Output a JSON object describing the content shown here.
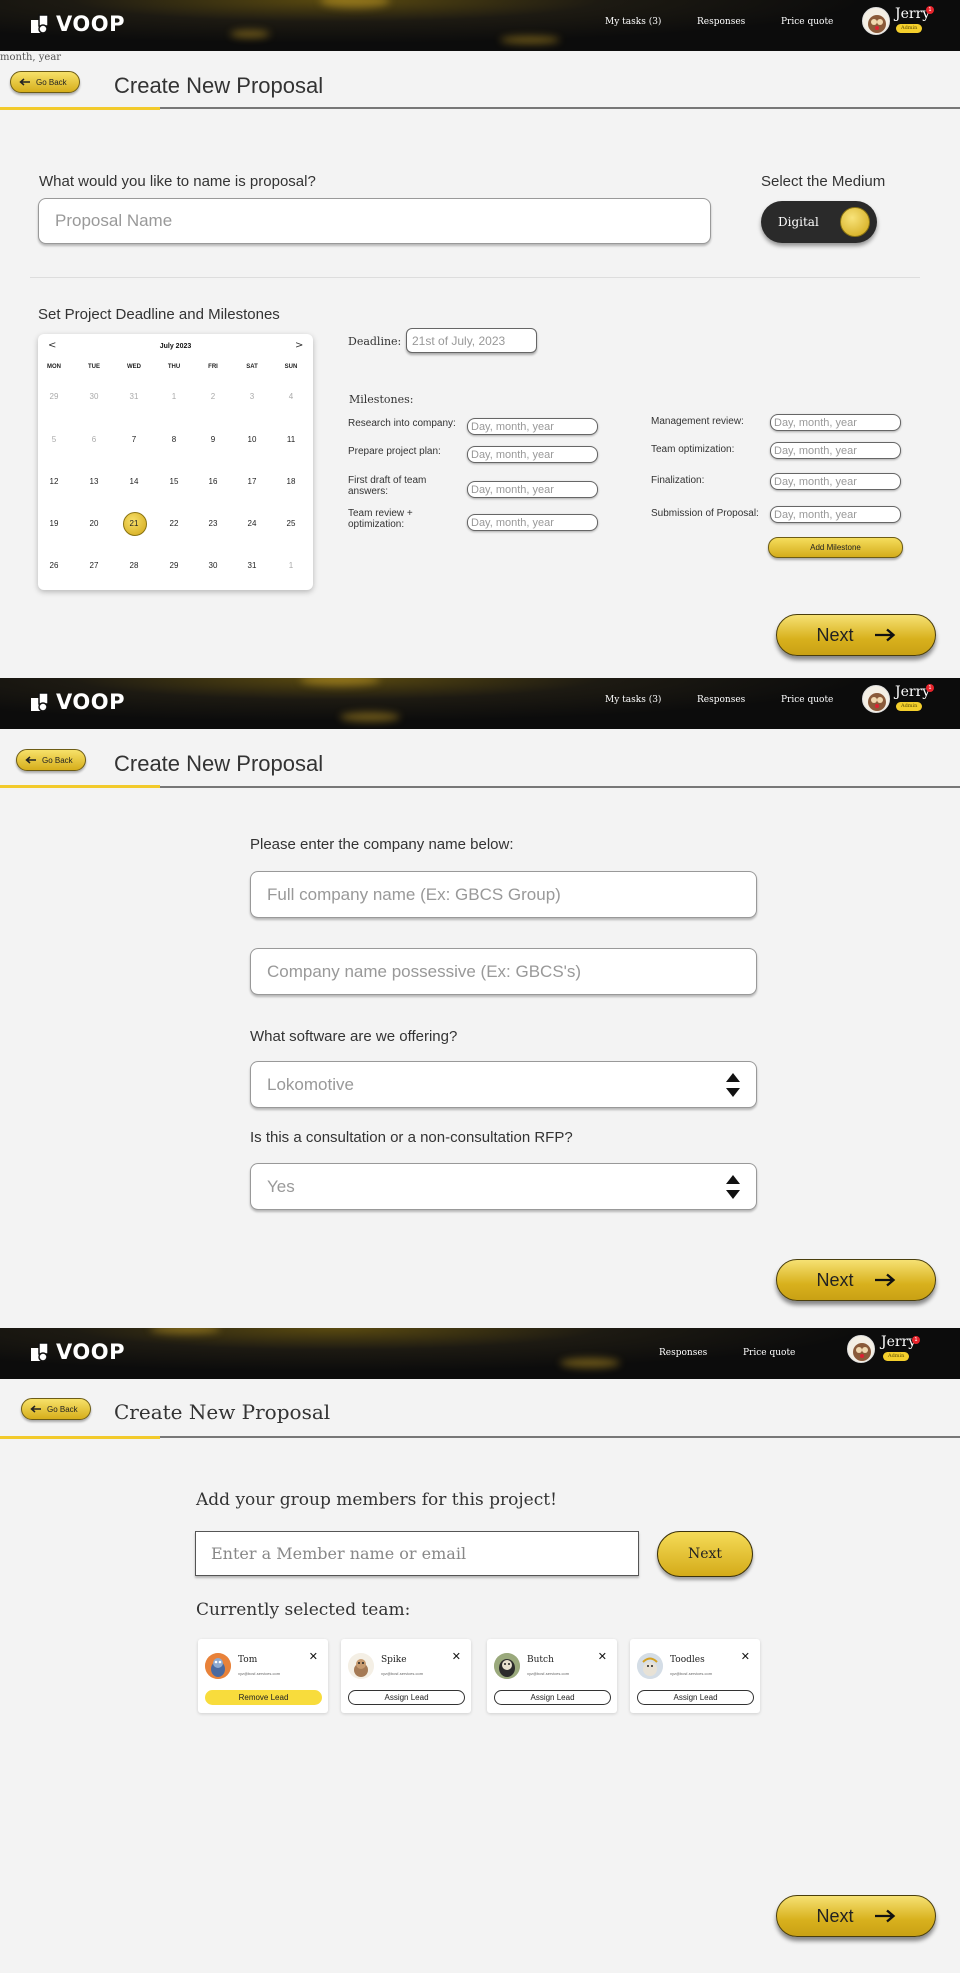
{
  "app": {
    "brand": "VOOP",
    "user": {
      "name": "Jerry",
      "role": "Admin",
      "notifications": "1"
    }
  },
  "screen1": {
    "nav": [
      "My tasks (3)",
      "Responses",
      "Price quote"
    ],
    "stray_text": "month, year",
    "go_back": "Go Back",
    "title": "Create New Proposal",
    "proposal_question": "What would you like to name is proposal?",
    "proposal_placeholder": "Proposal Name",
    "medium_label": "Select the Medium",
    "medium_value": "Digital",
    "deadline_section_title": "Set Project Deadline and Milestones",
    "calendar": {
      "month": "July 2023",
      "prev": "<",
      "next": ">",
      "weekdays": [
        "MON",
        "TUE",
        "WED",
        "THU",
        "FRI",
        "SAT",
        "SUN"
      ],
      "weeks": [
        [
          "29",
          "30",
          "31",
          "1",
          "2",
          "3",
          "4"
        ],
        [
          "5",
          "6",
          "7",
          "8",
          "9",
          "10",
          "11"
        ],
        [
          "12",
          "13",
          "14",
          "15",
          "16",
          "17",
          "18"
        ],
        [
          "19",
          "20",
          "21",
          "22",
          "23",
          "24",
          "25"
        ],
        [
          "26",
          "27",
          "28",
          "29",
          "30",
          "31",
          "1"
        ]
      ],
      "selected": "21"
    },
    "deadline_label": "Deadline:",
    "deadline_value": "21st of July, 2023",
    "milestones_label": "Milestones:",
    "milestones_left": [
      {
        "label": "Research into company:",
        "placeholder": "Day, month, year"
      },
      {
        "label": "Prepare project plan:",
        "placeholder": "Day, month, year"
      },
      {
        "label": "First draft of team answers:",
        "placeholder": "Day, month, year"
      },
      {
        "label": "Team review + optimization:",
        "placeholder": "Day, month, year"
      }
    ],
    "milestones_right": [
      {
        "label": "Management review:",
        "placeholder": "Day, month, year"
      },
      {
        "label": "Team optimization:",
        "placeholder": "Day, month, year"
      },
      {
        "label": "Finalization:",
        "placeholder": "Day, month, year"
      },
      {
        "label": "Submission of Proposal:",
        "placeholder": "Day, month, year"
      }
    ],
    "add_milestone": "Add Milestone",
    "next": "Next"
  },
  "screen2": {
    "nav": [
      "My tasks (3)",
      "Responses",
      "Price quote"
    ],
    "go_back": "Go Back",
    "title": "Create New Proposal",
    "company_question": "Please enter the company name below:",
    "company_full_placeholder": "Full company name (Ex: GBCS Group)",
    "company_possessive_placeholder": "Company name possessive (Ex: GBCS's)",
    "software_question": "What software are we offering?",
    "software_value": "Lokomotive",
    "rfp_question": "Is this a consultation or a non-consultation RFP?",
    "rfp_value": "Yes",
    "next": "Next"
  },
  "screen3": {
    "nav": [
      "Responses",
      "Price quote"
    ],
    "go_back": "Go Back",
    "title": "Create New Proposal",
    "members_question": "Add your group members for this project!",
    "member_placeholder": "Enter a Member name or email",
    "member_next": "Next",
    "team_label": "Currently selected team:",
    "team": [
      {
        "name": "Tom",
        "email": "xyz@bcsf-services.com",
        "action": "Remove Lead",
        "avatar": "cat-avatar",
        "bg": "#e8823a"
      },
      {
        "name": "Spike",
        "email": "xyz@bcsf-services.com",
        "action": "Assign Lead",
        "avatar": "dog-avatar",
        "bg": "#f4efe5"
      },
      {
        "name": "Butch",
        "email": "xyz@bcsf-services.com",
        "action": "Assign Lead",
        "avatar": "alley-cat-avatar",
        "bg": "#9aa97c"
      },
      {
        "name": "Toodles",
        "email": "xyz@bcsf-services.com",
        "action": "Assign Lead",
        "avatar": "toodles-avatar",
        "bg": "#d4dde6"
      }
    ],
    "next": "Next"
  }
}
